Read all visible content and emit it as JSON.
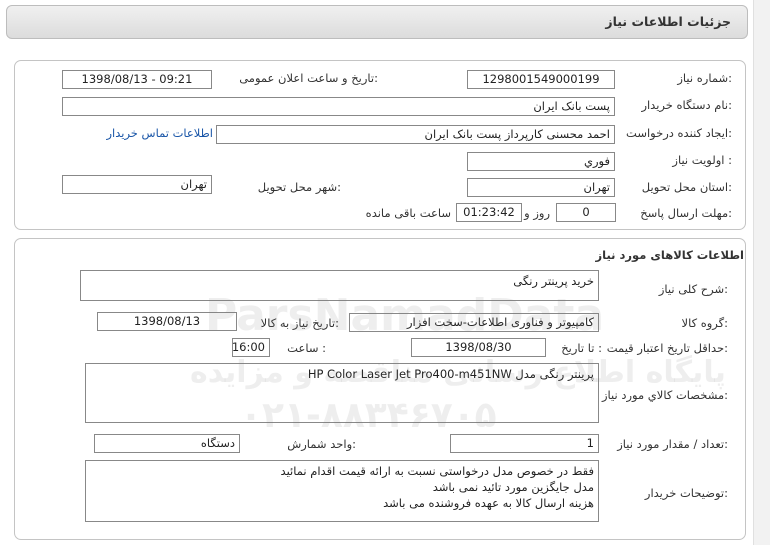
{
  "page": {
    "title": "جزئیات اطلاعات نیاز"
  },
  "info": {
    "need_number_label": "شماره نیاز:",
    "need_number": "1298001549000199",
    "announce_label": "تاریخ و ساعت اعلان عمومی:",
    "announce_value": "1398/08/13 - 09:21",
    "buyer_org_label": "نام دستگاه خریدار:",
    "buyer_org": "پست بانک ایران",
    "creator_label": "ایجاد کننده درخواست:",
    "creator": "احمد  محسنی کارپرداز پست بانک ایران",
    "contact_link": "اطلاعات تماس خریدار",
    "priority_label": "اولویت نیاز :",
    "priority": "فوري",
    "province_label": "استان محل تحویل:",
    "province": "تهران",
    "city_label": "شهر محل تحویل:",
    "city": "تهران",
    "deadline_label": "مهلت ارسال پاسخ:",
    "deadline_days": "0",
    "days_word": "روز و",
    "deadline_time": "01:23:42",
    "remaining_word": "ساعت باقی مانده"
  },
  "goods": {
    "section_title": "اطلاعات کالاهای مورد نیاز",
    "summary_label": "شرح کلی نیاز:",
    "summary": "خرید پرینتر رنگی",
    "group_label": "گروه کالا:",
    "group": "کامپیوتر و فناوری اطلاعات-سخت افزار",
    "need_date_label": "تاریخ نیاز به کالا:",
    "need_date": "1398/08/13",
    "validity_label": "حداقل تاریخ اعتبار قیمت:",
    "until_label": "تا تاریخ :",
    "validity_date": "1398/08/30",
    "hour_label": "ساعت :",
    "validity_time": "16:00",
    "spec_label": "مشخصات کالاي مورد نیاز:",
    "spec_prefix": "پرینتر رنگی مدل",
    "spec_model": "HP Color Laser Jet Pro400-m451NW",
    "qty_label": "تعداد / مقدار مورد نیاز:",
    "qty": "1",
    "unit_label": "واحد شمارش:",
    "unit": "دستگاه",
    "notes_label": "توضیحات خریدار:",
    "notes": [
      "فقط در خصوص مدل درخواستی نسبت به ارائه قیمت اقدام نمائید",
      "مدل جایگزین مورد تائید نمی باشد",
      "هزینه ارسال کالا به عهده فروشنده می باشد"
    ]
  },
  "watermark": {
    "brand": "ParsNamadData",
    "line1": "پایگاه اطلاع رسانی مناقصه و مزایده",
    "phone": "۰۲۱-۸۸۳۴۶۷۰۵"
  }
}
